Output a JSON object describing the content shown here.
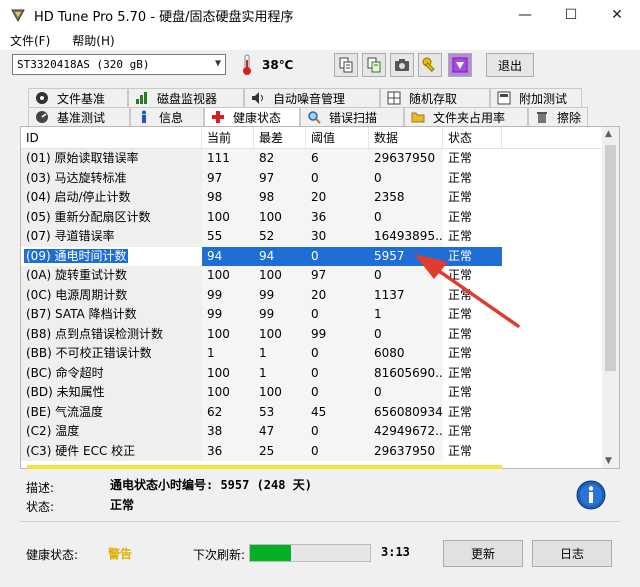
{
  "window": {
    "title": "HD Tune Pro 5.70 - 硬盘/固态硬盘实用程序",
    "minimize_glyph": "—",
    "maximize_glyph": "☐",
    "close_glyph": "✕"
  },
  "menu": [
    "文件(F)",
    "帮助(H)"
  ],
  "toolbar": {
    "drive": "ST3320418AS (320 gB)",
    "temperature": "38℃",
    "icons": [
      "copy-icon",
      "copy-info-icon",
      "screenshot-icon",
      "options-icon",
      "download-icon"
    ],
    "exit_label": "退出"
  },
  "tabs": {
    "row1": [
      {
        "label": "文件基准",
        "icon": "file-benchmark-icon"
      },
      {
        "label": "磁盘监视器",
        "icon": "disk-monitor-icon"
      },
      {
        "label": "自动噪音管理",
        "icon": "speaker-icon"
      },
      {
        "label": "随机存取",
        "icon": "random-access-icon"
      },
      {
        "label": "附加测试",
        "icon": "extra-tests-icon"
      }
    ],
    "row2": [
      {
        "label": "基准测试",
        "icon": "benchmark-icon"
      },
      {
        "label": "信息",
        "icon": "info-icon"
      },
      {
        "label": "健康状态",
        "icon": "health-cross-icon",
        "active": true
      },
      {
        "label": "错误扫描",
        "icon": "magnifier-icon"
      },
      {
        "label": "文件夹占用率",
        "icon": "folder-icon"
      },
      {
        "label": "擦除",
        "icon": "trash-icon"
      }
    ]
  },
  "table": {
    "headers": [
      "ID",
      "当前",
      "最差",
      "阈值",
      "数据",
      "状态"
    ],
    "rows": [
      [
        "(01) 原始读取错误率",
        "111",
        "82",
        "6",
        "29637950",
        "正常"
      ],
      [
        "(03) 马达旋转标准",
        "97",
        "97",
        "0",
        "0",
        "正常"
      ],
      [
        "(04) 启动/停止计数",
        "98",
        "98",
        "20",
        "2358",
        "正常"
      ],
      [
        "(05) 重新分配扇区计数",
        "100",
        "100",
        "36",
        "0",
        "正常"
      ],
      [
        "(07) 寻道错误率",
        "55",
        "52",
        "30",
        "16493895...",
        "正常"
      ],
      [
        "(09) 通电时间计数",
        "94",
        "94",
        "0",
        "5957",
        "正常"
      ],
      [
        "(0A) 旋转重试计数",
        "100",
        "100",
        "97",
        "0",
        "正常"
      ],
      [
        "(0C) 电源周期计数",
        "99",
        "99",
        "20",
        "1137",
        "正常"
      ],
      [
        "(B7) SATA 降档计数",
        "99",
        "99",
        "0",
        "1",
        "正常"
      ],
      [
        "(B8) 点到点错误检测计数",
        "100",
        "100",
        "99",
        "0",
        "正常"
      ],
      [
        "(BB) 不可校正错误计数",
        "1",
        "1",
        "0",
        "6080",
        "正常"
      ],
      [
        "(BC) 命令超时",
        "100",
        "1",
        "0",
        "81605690...",
        "正常"
      ],
      [
        "(BD) 未知属性",
        "100",
        "100",
        "0",
        "0",
        "正常"
      ],
      [
        "(BE) 气流温度",
        "62",
        "53",
        "45",
        "656080934",
        "正常"
      ],
      [
        "(C2) 温度",
        "38",
        "47",
        "0",
        "42949672...",
        "正常"
      ],
      [
        "(C3) 硬件 ECC 校正",
        "36",
        "25",
        "0",
        "29637950",
        "正常"
      ]
    ],
    "selected_row": 5
  },
  "details": {
    "desc_label": "描述:",
    "desc_value": "通电状态小时编号: 5957 (248 天)",
    "status_label": "状态:",
    "status_value": "正常"
  },
  "footer": {
    "health_label": "健康状态:",
    "health_value": "警告",
    "health_color": "#e0b000",
    "refresh_label": "下次刷新:",
    "refresh_progress": 0.34,
    "countdown": "3:13",
    "update_label": "更新",
    "log_label": "日志"
  }
}
